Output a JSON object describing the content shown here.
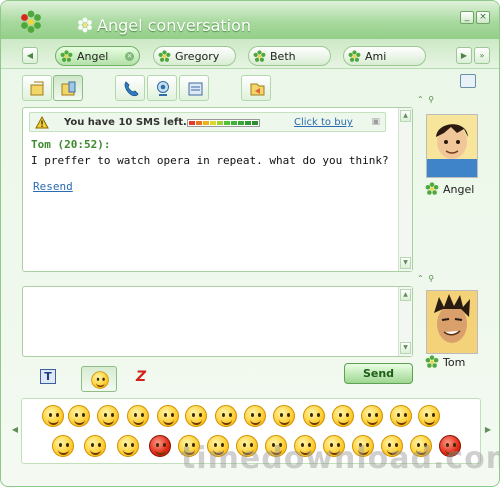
{
  "window": {
    "title": "Angel conversation",
    "minimize_label": "_",
    "close_label": "×"
  },
  "tabs": [
    {
      "label": "Angel",
      "active": true
    },
    {
      "label": "Gregory",
      "active": false
    },
    {
      "label": "Beth",
      "active": false
    },
    {
      "label": "Ami",
      "active": false
    }
  ],
  "toolbar": {
    "icons": [
      "message-mode-icon",
      "sms-mode-icon",
      "call-icon",
      "webcam-icon",
      "phone-book-icon",
      "send-file-icon"
    ]
  },
  "sms_notice": {
    "text": "You have 10 SMS left.",
    "link": "Click to buy",
    "remaining": 10,
    "meter_colors": [
      "#e23b2a",
      "#e8731e",
      "#f0b01a",
      "#d9d92a",
      "#9fd132",
      "#52c235",
      "#3db53a",
      "#37a838",
      "#2f9c33",
      "#2a8f2e"
    ]
  },
  "message": {
    "sender": "Tom (20:52):",
    "text": "I preffer to watch opera in repeat. what do you think?",
    "resend": "Resend"
  },
  "contact": {
    "name": "Angel"
  },
  "self": {
    "name": "Tom"
  },
  "format": {
    "text_style_label": "T",
    "nudge_label": "Z"
  },
  "send_label": "Send",
  "watermark": "timedownload.com",
  "colors": {
    "accent": "#7fc373",
    "link": "#2a6cb0",
    "sender": "#3c8c2e"
  }
}
